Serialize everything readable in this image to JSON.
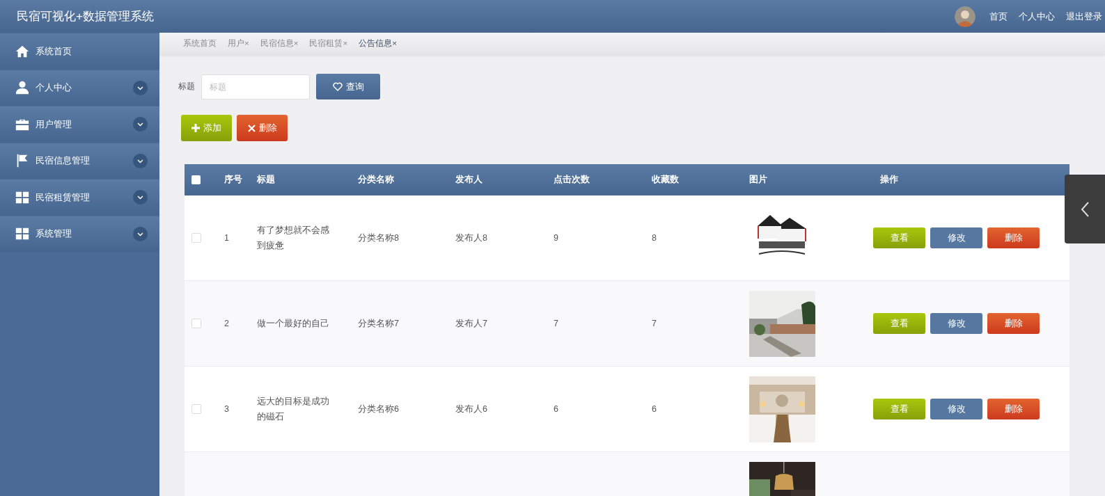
{
  "header": {
    "title": "民宿可视化+数据管理系统",
    "nav": [
      "首页",
      "个人中心",
      "退出登录"
    ]
  },
  "sidebar": {
    "items": [
      {
        "label": "系统首页",
        "kind": "link"
      },
      {
        "label": "个人中心",
        "kind": "menu",
        "expanded": false
      },
      {
        "label": "用户管理",
        "kind": "menu",
        "expanded": false
      },
      {
        "label": "民宿信息管理",
        "kind": "menu",
        "expanded": false
      },
      {
        "label": "民宿租赁管理",
        "kind": "menu",
        "expanded": false
      },
      {
        "label": "系统管理",
        "kind": "menu",
        "expanded": false
      }
    ]
  },
  "tabs": [
    {
      "label": "系统首页",
      "selected": false
    },
    {
      "label": "用户",
      "close_mark": "×",
      "selected": false
    },
    {
      "label": "民宿信息",
      "close_mark": "×",
      "selected": false
    },
    {
      "label": "民宿租赁",
      "close_mark": "×",
      "selected": false
    },
    {
      "label": "公告信息",
      "close_mark": "×",
      "selected": true
    }
  ],
  "search": {
    "label": "标题",
    "placeholder": "标题",
    "button": "查询"
  },
  "actions": [
    {
      "label": "添加",
      "kind": "add"
    },
    {
      "label": "删除",
      "kind": "delete"
    }
  ],
  "table": {
    "header_checked": false,
    "columns": [
      "序号",
      "标题",
      "分类名称",
      "发布人",
      "点击次数",
      "收藏数",
      "图片",
      "操作"
    ],
    "rows": [
      {
        "checked": false,
        "index": "1",
        "title": "有了梦想就不会感到疲惫",
        "category": "分类名称8",
        "publisher": "发布人8",
        "clicks": "9",
        "favorites": "8",
        "image": {
          "kind": "picture"
        },
        "actions": [
          "查看",
          "修改",
          "删除"
        ]
      },
      {
        "checked": false,
        "index": "2",
        "title": "做一个最好的自己",
        "category": "分类名称7",
        "publisher": "发布人7",
        "clicks": "7",
        "favorites": "7",
        "image": {
          "kind": "picture"
        },
        "actions": [
          "查看",
          "修改",
          "删除"
        ]
      },
      {
        "checked": false,
        "index": "3",
        "title": "远大的目标是成功的磁石",
        "category": "分类名称6",
        "publisher": "发布人6",
        "clicks": "6",
        "favorites": "6",
        "image": {
          "kind": "picture"
        },
        "actions": [
          "查看",
          "修改",
          "删除"
        ]
      },
      {
        "image": {
          "kind": "picture"
        }
      }
    ]
  }
}
